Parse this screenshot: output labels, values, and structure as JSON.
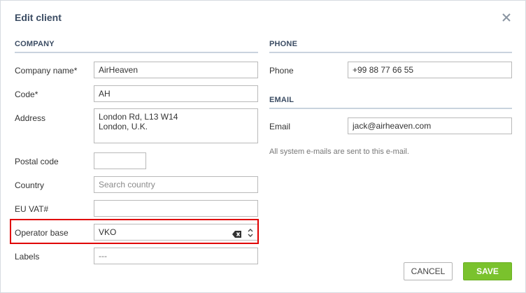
{
  "dialog": {
    "title": "Edit client"
  },
  "company": {
    "section_title": "COMPANY",
    "company_name_label": "Company name*",
    "company_name_value": "AirHeaven",
    "code_label": "Code*",
    "code_value": "AH",
    "address_label": "Address",
    "address_value": "London Rd, L13 W14\nLondon, U.K.",
    "postal_code_label": "Postal code",
    "postal_code_value": "",
    "country_label": "Country",
    "country_placeholder": "Search country",
    "eu_vat_label": "EU VAT#",
    "eu_vat_value": "",
    "operator_base_label": "Operator base",
    "operator_base_value": "VKO",
    "labels_label": "Labels",
    "labels_value": "---"
  },
  "phone": {
    "section_title": "PHONE",
    "phone_label": "Phone",
    "phone_value": "+99 88 77 66 55"
  },
  "email": {
    "section_title": "EMAIL",
    "email_label": "Email",
    "email_value": "jack@airheaven.com",
    "hint": "All system e-mails are sent to this e-mail."
  },
  "buttons": {
    "cancel_label": "CANCEL",
    "save_label": "SAVE"
  },
  "colors": {
    "accent_green": "#7ac22d",
    "section_title": "#3b4c63",
    "highlight_red": "#e00000"
  },
  "icons": {
    "close": "close-icon",
    "clear": "clear-icon",
    "select_arrows": "chevron-updown-icon"
  }
}
